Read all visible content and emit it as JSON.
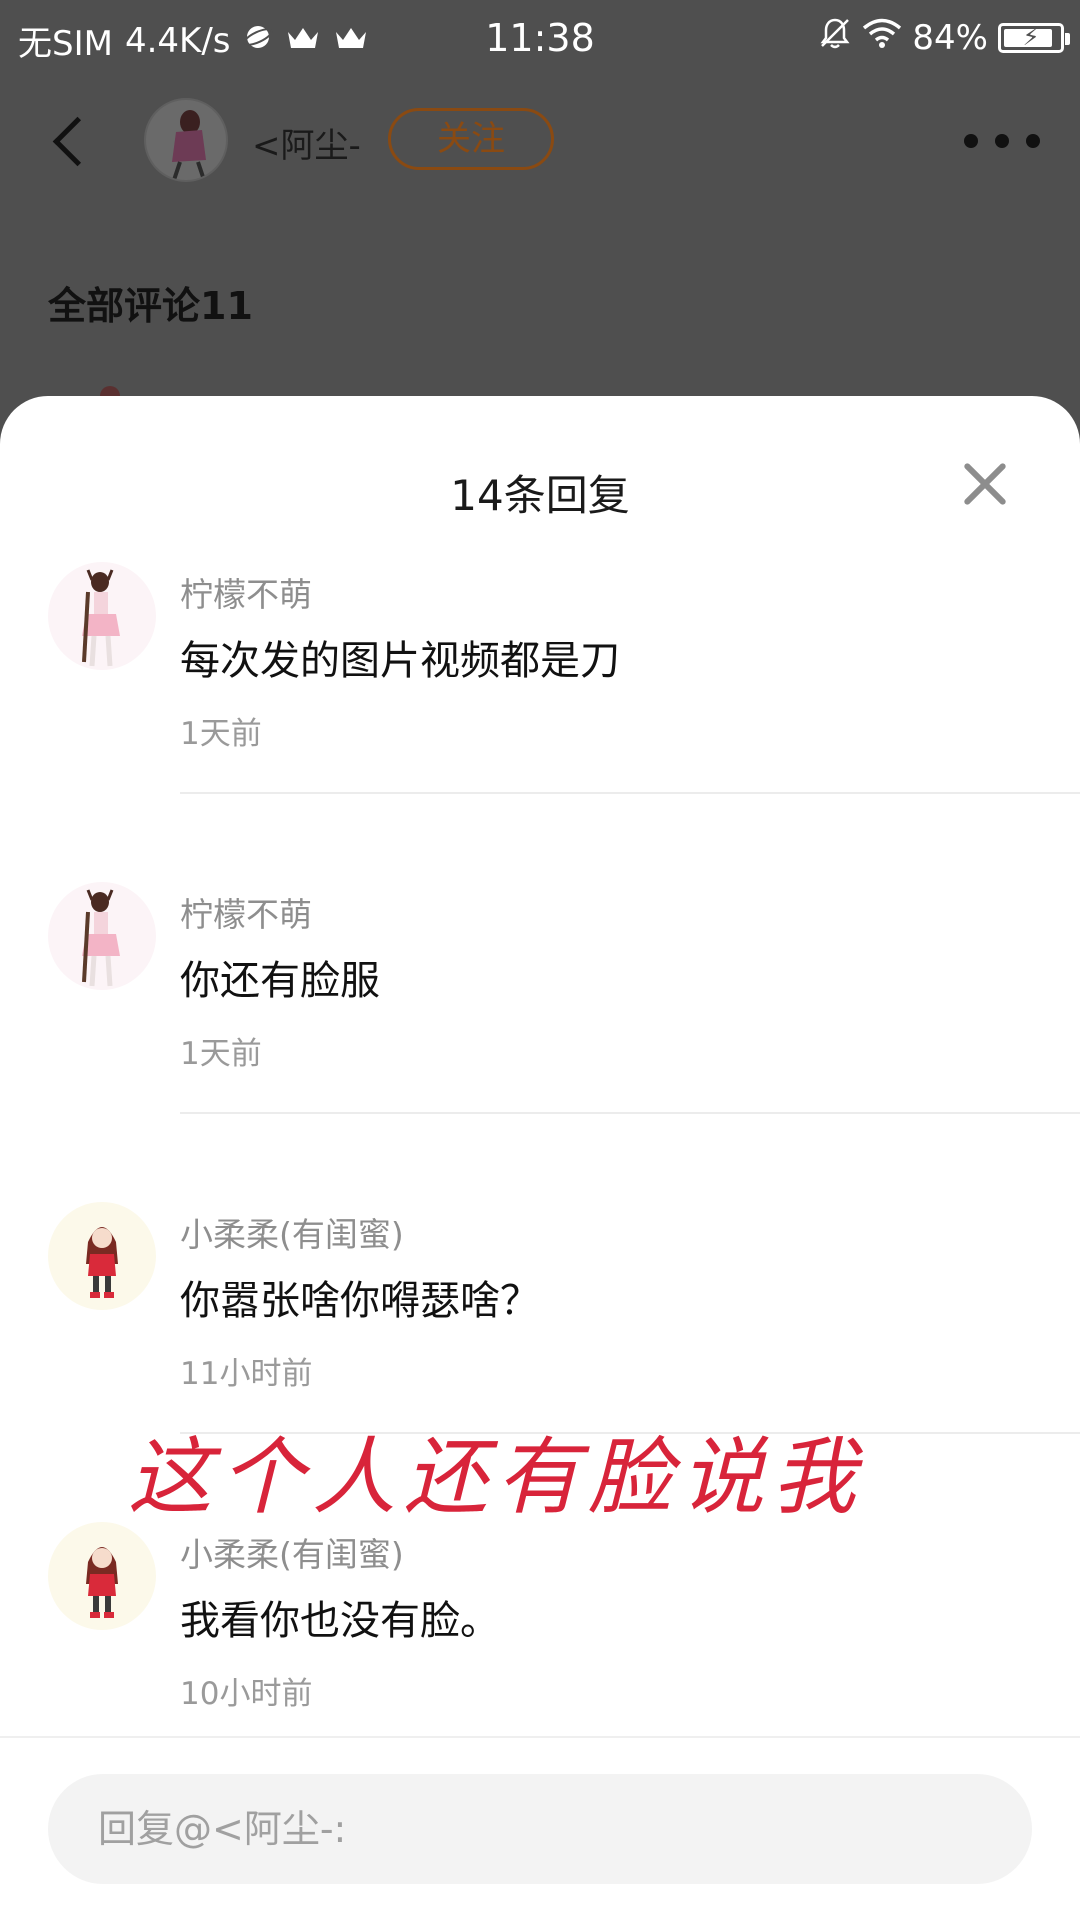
{
  "status_bar": {
    "carrier": "无SIM",
    "speed": "4.4K/s",
    "time": "11:38",
    "battery": "84%"
  },
  "topbar": {
    "author_name": "<阿尘-",
    "follow_label": "关注"
  },
  "comments_header": "全部评论11",
  "sheet": {
    "title": "14条回复",
    "replies": [
      {
        "user": "柠檬不萌",
        "text": "每次发的图片视频都是刀",
        "time": "1天前"
      },
      {
        "user": "柠檬不萌",
        "text": "你还有脸服",
        "time": "1天前"
      },
      {
        "user": "小柔柔(有闺蜜)",
        "text": "你嚣张啥你嘚瑟啥？",
        "time": "11小时前"
      },
      {
        "user": "小柔柔(有闺蜜)",
        "text": "我看你也没有脸。",
        "time": "10小时前"
      }
    ]
  },
  "watermark": "这个人还有脸说我",
  "reply_input": {
    "placeholder": "回复@<阿尘-:"
  },
  "colors": {
    "accent": "#8a4a12",
    "watermark": "#d8243a",
    "dim_overlay": "#4f4f4f"
  }
}
